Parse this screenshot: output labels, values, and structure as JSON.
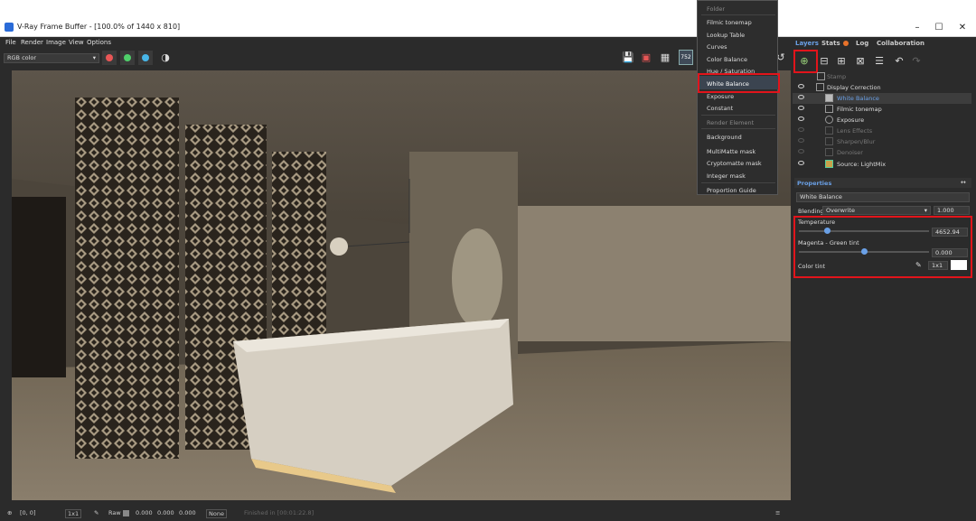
{
  "window": {
    "title": "V-Ray Frame Buffer - [100.0% of 1440 x 810]",
    "controls": [
      "–",
      "☐",
      "✕"
    ]
  },
  "menu": [
    "File",
    "Render",
    "Image",
    "View",
    "Options"
  ],
  "toolbar": {
    "channel": "RGB color",
    "badge": "752"
  },
  "dropdown": {
    "items": [
      {
        "label": "Folder",
        "header": true
      },
      {
        "label": "Filmic tonemap"
      },
      {
        "label": "Lookup Table"
      },
      {
        "label": "Curves"
      },
      {
        "label": "Color Balance"
      },
      {
        "label": "Hue / Saturation"
      },
      {
        "label": "White Balance",
        "highlight": true
      },
      {
        "label": "Exposure"
      },
      {
        "label": "Constant"
      },
      {
        "label": "Render Element",
        "header": true
      },
      {
        "label": "Background"
      },
      {
        "label": "MultiMatte mask"
      },
      {
        "label": "Cryptomatte mask"
      },
      {
        "label": "Integer mask"
      },
      {
        "label": "Proportion Guide"
      }
    ]
  },
  "tabs": [
    "Layers",
    "Stats",
    "Log",
    "Collaboration"
  ],
  "layers": [
    {
      "label": "Stamp",
      "enabled": false
    },
    {
      "label": "Display Correction",
      "enabled": true
    },
    {
      "label": "White Balance",
      "enabled": true,
      "selected": true
    },
    {
      "label": "Filmic tonemap",
      "enabled": true
    },
    {
      "label": "Exposure",
      "enabled": true
    },
    {
      "label": "Lens Effects",
      "enabled": false
    },
    {
      "label": "Sharpen/Blur",
      "enabled": false
    },
    {
      "label": "Denoiser",
      "enabled": false
    },
    {
      "label": "Source: LightMix",
      "enabled": true
    }
  ],
  "properties": {
    "header": "Properties",
    "layer_name": "White Balance",
    "blending_label": "Blending",
    "blending_mode": "Overwrite",
    "blending_value": "1.000",
    "temperature_label": "Temperature",
    "temperature_value": "4652.94",
    "temperature_level": 0.22,
    "tint_label": "Magenta - Green tint",
    "tint_value": "0.000",
    "tint_level": 0.5,
    "color_tint_label": "Color tint",
    "color_tint_mode": "1x1"
  },
  "status": {
    "coords": "[0, 0]",
    "zoom": "1x1",
    "mode": "Raw",
    "r": "0.000",
    "g": "0.000",
    "b": "0.000",
    "profile": "None",
    "message": "Finished in [00:01:22.8]"
  },
  "colors": {
    "accent": "#6aa0e6",
    "highlight": "#e2141b",
    "red_dot": "#e85656",
    "green_dot": "#4fcf6a",
    "blue_dot": "#48b6e8"
  }
}
